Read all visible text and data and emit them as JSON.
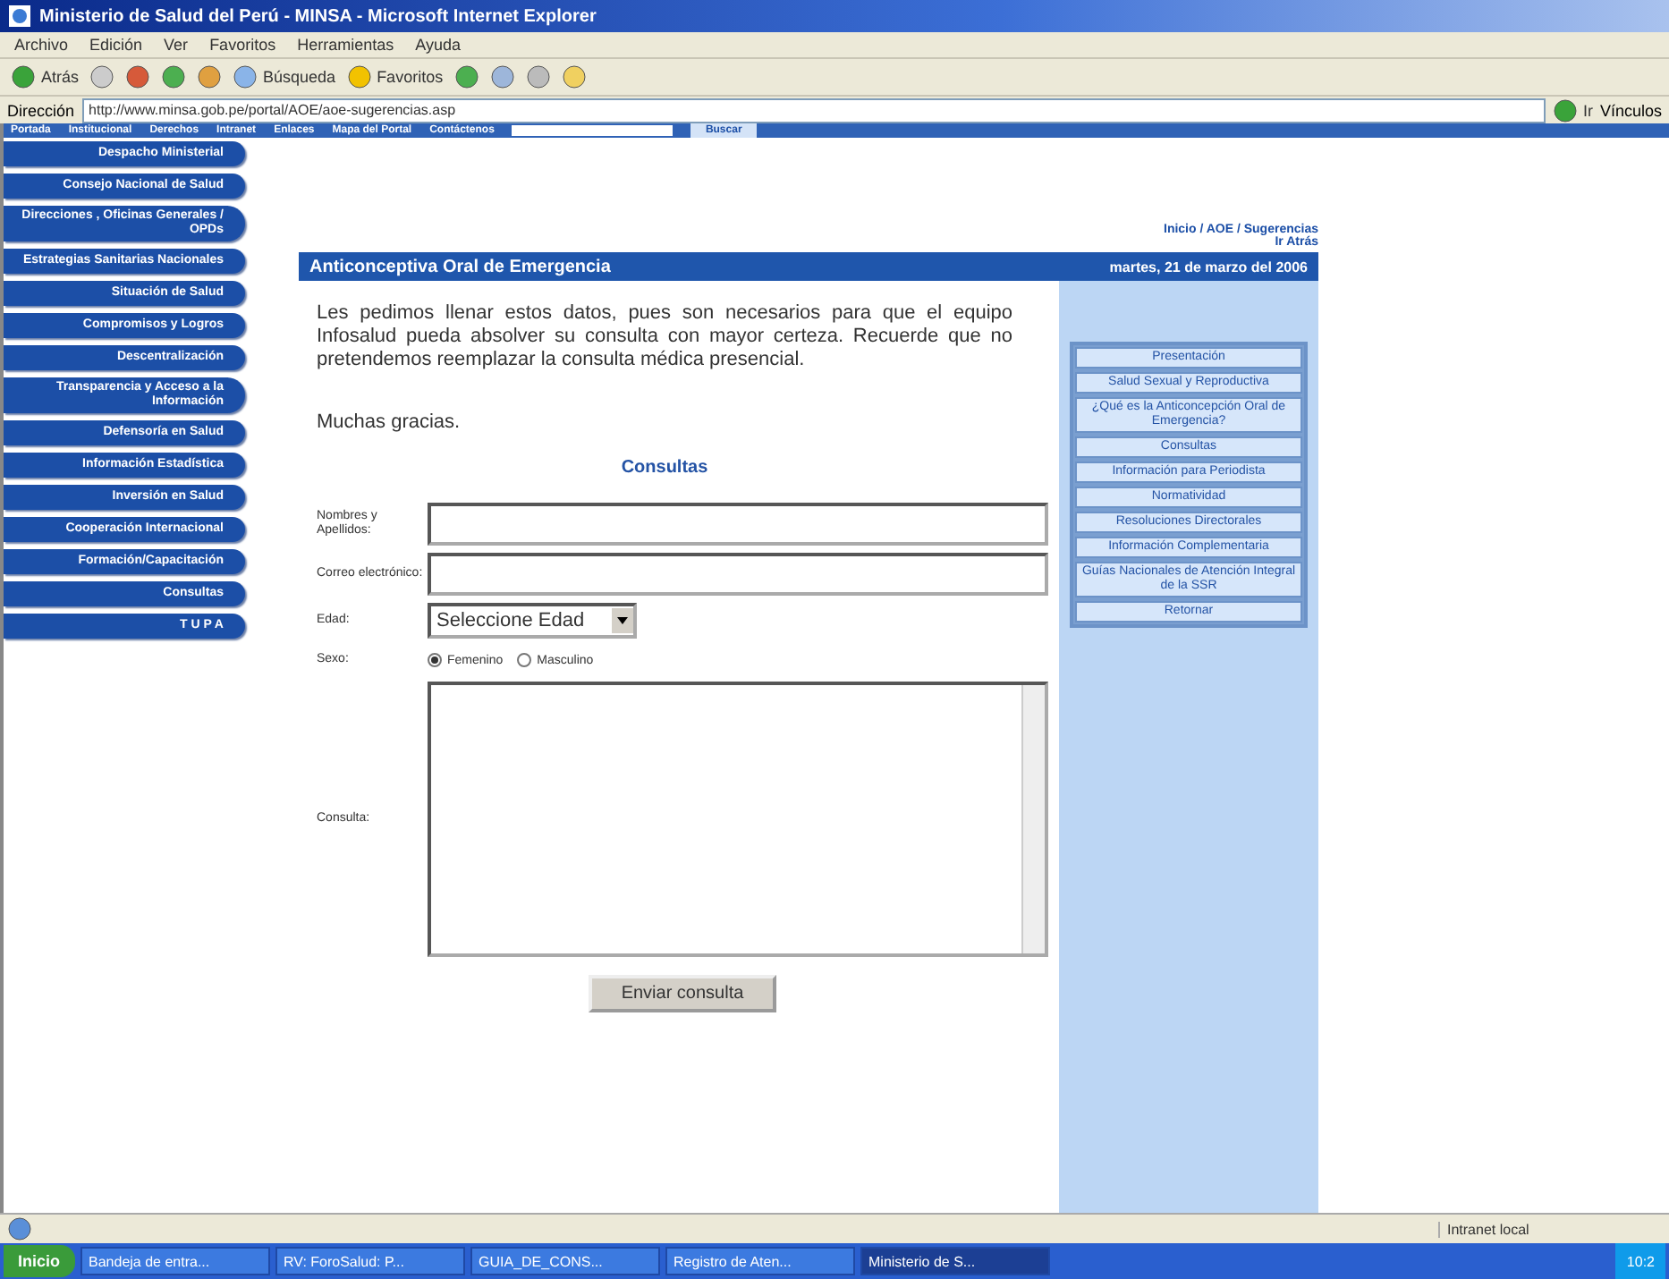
{
  "window": {
    "title": "Ministerio de Salud del Perú - MINSA - Microsoft Internet Explorer"
  },
  "menu": [
    "Archivo",
    "Edición",
    "Ver",
    "Favoritos",
    "Herramientas",
    "Ayuda"
  ],
  "toolbar": {
    "back": "Atrás",
    "search": "Búsqueda",
    "favorites": "Favoritos"
  },
  "address": {
    "label": "Dirección",
    "url": "http://www.minsa.gob.pe/portal/AOE/aoe-sugerencias.asp",
    "go": "Ir",
    "links": "Vínculos"
  },
  "portal_nav": {
    "items": [
      "Portada",
      "Institucional",
      "Derechos",
      "Intranet",
      "Enlaces",
      "Mapa del Portal",
      "Contáctenos"
    ],
    "search_button": "Buscar"
  },
  "left_nav": [
    "Despacho Ministerial",
    "Consejo Nacional de Salud",
    "Direcciones , Oficinas Generales / OPDs",
    "Estrategias Sanitarias Nacionales",
    "Situación de Salud",
    "Compromisos y Logros",
    "Descentralización",
    "Transparencia y Acceso a la Información",
    "Defensoría en Salud",
    "Información Estadística",
    "Inversión en Salud",
    "Cooperación Internacional",
    "Formación/Capacitación",
    "Consultas",
    "T U P A"
  ],
  "breadcrumb": "Inicio / AOE / Sugerencias",
  "back_link": "Ir Atrás",
  "header": {
    "title": "Anticonceptiva Oral de Emergencia",
    "date": "martes, 21 de marzo del 2006"
  },
  "intro": "Les pedimos llenar estos datos, pues son necesarios para que el equipo Infosalud pueda absolver su consulta con mayor certeza. Recuerde que no pretendemos reemplazar la consulta médica presencial.",
  "thanks": "Muchas gracias.",
  "form": {
    "title": "Consultas",
    "fields": [
      {
        "kind": "text",
        "label": "Nombres y Apellidos:"
      },
      {
        "kind": "text",
        "label": "Correo electrónico:"
      },
      {
        "kind": "select",
        "label": "Edad:",
        "value": "Seleccione Edad"
      },
      {
        "kind": "radio",
        "label": "Sexo:",
        "options": [
          {
            "label": "Femenino",
            "selected": true
          },
          {
            "label": "Masculino",
            "selected": false
          }
        ]
      },
      {
        "kind": "textarea",
        "label": "Consulta:"
      }
    ],
    "submit": "Enviar consulta"
  },
  "side_menu": [
    "Presentación",
    "Salud Sexual y Reproductiva",
    "¿Qué es la Anticoncepción Oral de Emergencia?",
    "Consultas",
    "Información para Periodista",
    "Normatividad",
    "Resoluciones Directorales",
    "Información Complementaria",
    "Guías Nacionales de Atención Integral de la SSR",
    "Retornar"
  ],
  "status_bar": {
    "zone": "Intranet local"
  },
  "taskbar": {
    "start": "Inicio",
    "items": [
      {
        "label": "Bandeja de entra...",
        "selected": false
      },
      {
        "label": "RV: ForoSalud: P...",
        "selected": false
      },
      {
        "label": "GUIA_DE_CONS...",
        "selected": false
      },
      {
        "label": "Registro de Aten...",
        "selected": false
      },
      {
        "label": "Ministerio de S...",
        "selected": true
      }
    ],
    "clock": "10:2"
  }
}
